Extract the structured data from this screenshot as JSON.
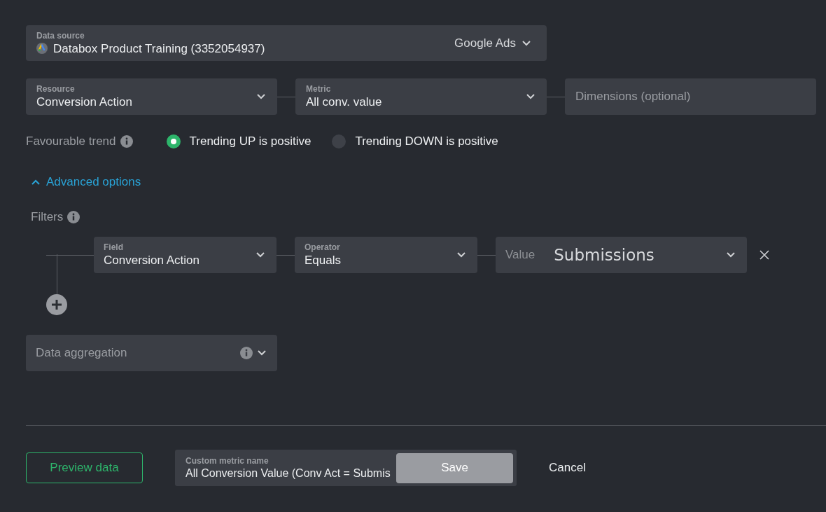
{
  "data_source": {
    "label": "Data source",
    "account": "Databox Product Training (3352054937)",
    "connector": "Google Ads"
  },
  "selects": [
    {
      "kind": "select",
      "label": "Resource",
      "value": "Conversion Action"
    },
    {
      "kind": "select",
      "label": "Metric",
      "value": "All conv. value"
    },
    {
      "kind": "placeholder",
      "placeholder": "Dimensions (optional)"
    }
  ],
  "trend": {
    "label": "Favourable trend",
    "options": [
      {
        "label": "Trending UP is positive",
        "selected": true
      },
      {
        "label": "Trending DOWN is positive",
        "selected": false
      }
    ]
  },
  "advanced_options": {
    "label": "Advanced options",
    "expanded": true
  },
  "filters": {
    "label": "Filters",
    "rows": [
      {
        "field": {
          "label": "Field",
          "value": "Conversion Action"
        },
        "operator": {
          "label": "Operator",
          "value": "Equals"
        },
        "value": {
          "label": "Value",
          "value": "Submissions"
        }
      }
    ]
  },
  "data_aggregation": {
    "placeholder": "Data aggregation"
  },
  "footer": {
    "preview_button": "Preview data",
    "custom_metric_name": {
      "label": "Custom metric name",
      "value": "All Conversion Value (Conv Act = Submis"
    },
    "save_button": "Save",
    "cancel_button": "Cancel"
  }
}
